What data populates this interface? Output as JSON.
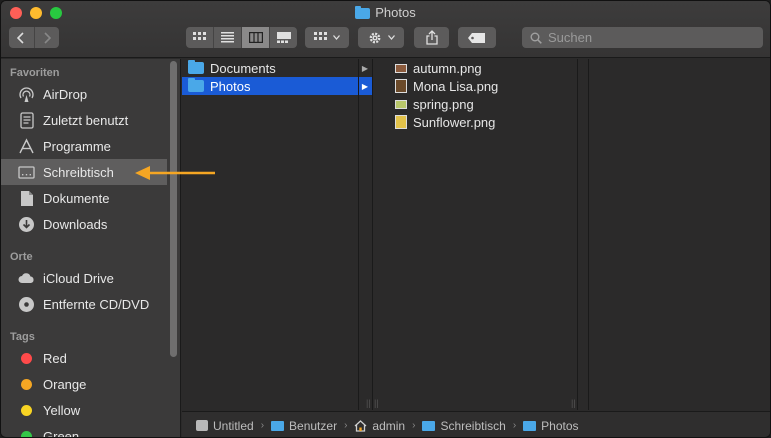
{
  "window": {
    "title": "Photos"
  },
  "toolbar": {
    "search_placeholder": "Suchen"
  },
  "sidebar": {
    "sections": [
      {
        "heading": "Favoriten"
      },
      {
        "heading": "Orte"
      },
      {
        "heading": "Tags"
      }
    ],
    "favorites": [
      {
        "label": "AirDrop",
        "icon": "airdrop-icon"
      },
      {
        "label": "Zuletzt benutzt",
        "icon": "recents-icon"
      },
      {
        "label": "Programme",
        "icon": "applications-icon"
      },
      {
        "label": "Schreibtisch",
        "icon": "desktop-icon",
        "selected": true
      },
      {
        "label": "Dokumente",
        "icon": "documents-icon"
      },
      {
        "label": "Downloads",
        "icon": "downloads-icon"
      }
    ],
    "locations": [
      {
        "label": "iCloud Drive",
        "icon": "cloud-icon"
      },
      {
        "label": "Entfernte CD/DVD",
        "icon": "disc-icon"
      }
    ],
    "tags": [
      {
        "label": "Red",
        "color": "#ff4a4a"
      },
      {
        "label": "Orange",
        "color": "#f5a623"
      },
      {
        "label": "Yellow",
        "color": "#f8d423"
      },
      {
        "label": "Green",
        "color": "#33c748"
      }
    ]
  },
  "columns": {
    "col1": [
      {
        "label": "Documents"
      },
      {
        "label": "Photos",
        "selected": true
      }
    ],
    "col2": [
      {
        "label": "autumn.png"
      },
      {
        "label": "Mona Lisa.png"
      },
      {
        "label": "spring.png"
      },
      {
        "label": "Sunflower.png"
      }
    ]
  },
  "pathbar": [
    "Untitled",
    "Benutzer",
    "admin",
    "Schreibtisch",
    "Photos"
  ],
  "colors": {
    "accent_selection": "#1a5bd6",
    "arrow": "#f5a623",
    "folder": "#4aa8e8"
  }
}
